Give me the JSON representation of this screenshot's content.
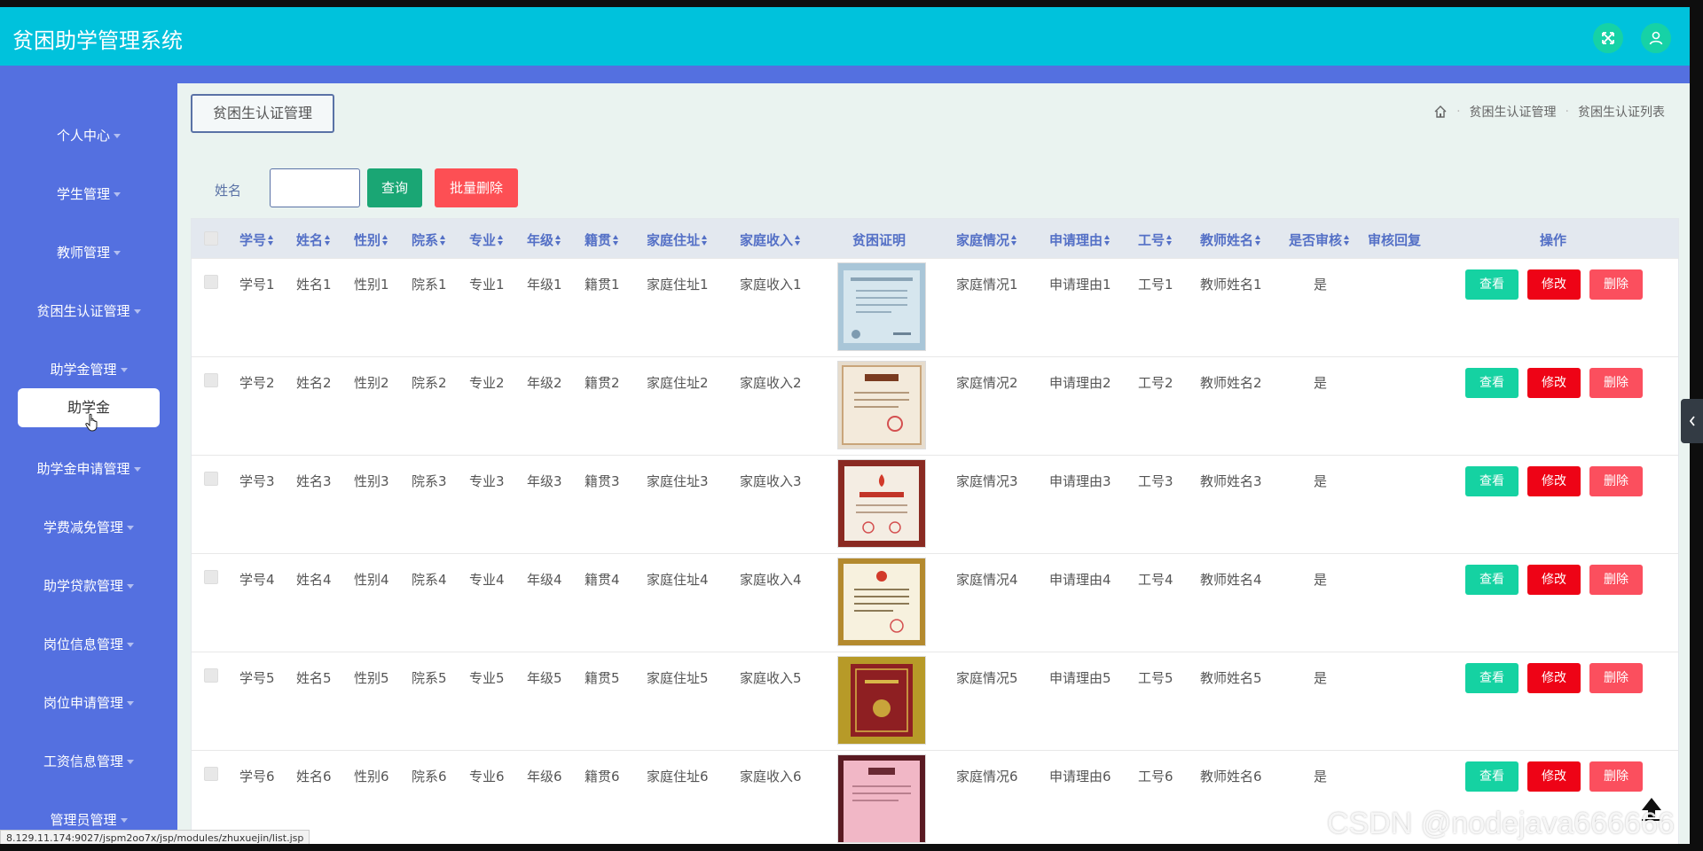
{
  "header": {
    "title": "贫困助学管理系统"
  },
  "sidebar": {
    "items": [
      {
        "label": "个人中心"
      },
      {
        "label": "学生管理"
      },
      {
        "label": "教师管理"
      },
      {
        "label": "贫困生认证管理"
      },
      {
        "label": "助学金管理"
      },
      {
        "label": "助学金申请管理"
      },
      {
        "label": "学费减免管理"
      },
      {
        "label": "助学贷款管理"
      },
      {
        "label": "岗位信息管理"
      },
      {
        "label": "岗位申请管理"
      },
      {
        "label": "工资信息管理"
      },
      {
        "label": "管理员管理"
      }
    ],
    "active_sub": "助学金"
  },
  "page": {
    "tag": "贫困生认证管理",
    "breadcrumb": [
      "贫困生认证管理",
      "贫困生认证列表"
    ]
  },
  "search": {
    "label": "姓名",
    "value": "",
    "placeholder": "",
    "query_label": "查询",
    "batch_delete_label": "批量删除"
  },
  "table": {
    "columns": [
      "学号",
      "姓名",
      "性别",
      "院系",
      "专业",
      "年级",
      "籍贯",
      "家庭住址",
      "家庭收入",
      "贫困证明",
      "家庭情况",
      "申请理由",
      "工号",
      "教师姓名",
      "是否审核",
      "审核回复",
      "操作"
    ],
    "actions": {
      "view": "查看",
      "edit": "修改",
      "delete": "删除"
    },
    "rows": [
      {
        "xuehao": "学号1",
        "name": "姓名1",
        "gender": "性别1",
        "dept": "院系1",
        "major": "专业1",
        "grade": "年级1",
        "origin": "籍贯1",
        "address": "家庭住址1",
        "income": "家庭收入1",
        "situation": "家庭情况1",
        "reason": "申请理由1",
        "gonghao": "工号1",
        "teacher": "教师姓名1",
        "audited": "是",
        "reply": ""
      },
      {
        "xuehao": "学号2",
        "name": "姓名2",
        "gender": "性别2",
        "dept": "院系2",
        "major": "专业2",
        "grade": "年级2",
        "origin": "籍贯2",
        "address": "家庭住址2",
        "income": "家庭收入2",
        "situation": "家庭情况2",
        "reason": "申请理由2",
        "gonghao": "工号2",
        "teacher": "教师姓名2",
        "audited": "是",
        "reply": ""
      },
      {
        "xuehao": "学号3",
        "name": "姓名3",
        "gender": "性别3",
        "dept": "院系3",
        "major": "专业3",
        "grade": "年级3",
        "origin": "籍贯3",
        "address": "家庭住址3",
        "income": "家庭收入3",
        "situation": "家庭情况3",
        "reason": "申请理由3",
        "gonghao": "工号3",
        "teacher": "教师姓名3",
        "audited": "是",
        "reply": ""
      },
      {
        "xuehao": "学号4",
        "name": "姓名4",
        "gender": "性别4",
        "dept": "院系4",
        "major": "专业4",
        "grade": "年级4",
        "origin": "籍贯4",
        "address": "家庭住址4",
        "income": "家庭收入4",
        "situation": "家庭情况4",
        "reason": "申请理由4",
        "gonghao": "工号4",
        "teacher": "教师姓名4",
        "audited": "是",
        "reply": ""
      },
      {
        "xuehao": "学号5",
        "name": "姓名5",
        "gender": "性别5",
        "dept": "院系5",
        "major": "专业5",
        "grade": "年级5",
        "origin": "籍贯5",
        "address": "家庭住址5",
        "income": "家庭收入5",
        "situation": "家庭情况5",
        "reason": "申请理由5",
        "gonghao": "工号5",
        "teacher": "教师姓名5",
        "audited": "是",
        "reply": ""
      },
      {
        "xuehao": "学号6",
        "name": "姓名6",
        "gender": "性别6",
        "dept": "院系6",
        "major": "专业6",
        "grade": "年级6",
        "origin": "籍贯6",
        "address": "家庭住址6",
        "income": "家庭收入6",
        "situation": "家庭情况6",
        "reason": "申请理由6",
        "gonghao": "工号6",
        "teacher": "教师姓名6",
        "audited": "是",
        "reply": ""
      }
    ]
  },
  "statusbar": {
    "url": "8.129.11.174:9027/jspm2oo7x/jsp/modules/zhuxuejin/list.jsp"
  },
  "watermark": {
    "text": "CSDN @nodejava666666"
  },
  "icons": {
    "fullscreen": "fullscreen-icon",
    "user": "user-icon",
    "home": "home-icon",
    "sort": "sort-icon",
    "cursor": "hand-cursor-icon",
    "collapse": "chevron-left-icon",
    "back_to_top": "arrow-up-icon"
  },
  "colors": {
    "header": "#00c2dc",
    "sidebar": "#5470e0",
    "content_bg": "#eaf3f0",
    "query_button": "#1aa674",
    "batch_delete": "#fd4f54",
    "view_button": "#15d2a2",
    "edit_button": "#ee0316",
    "delete_button": "#fb4f5e"
  }
}
